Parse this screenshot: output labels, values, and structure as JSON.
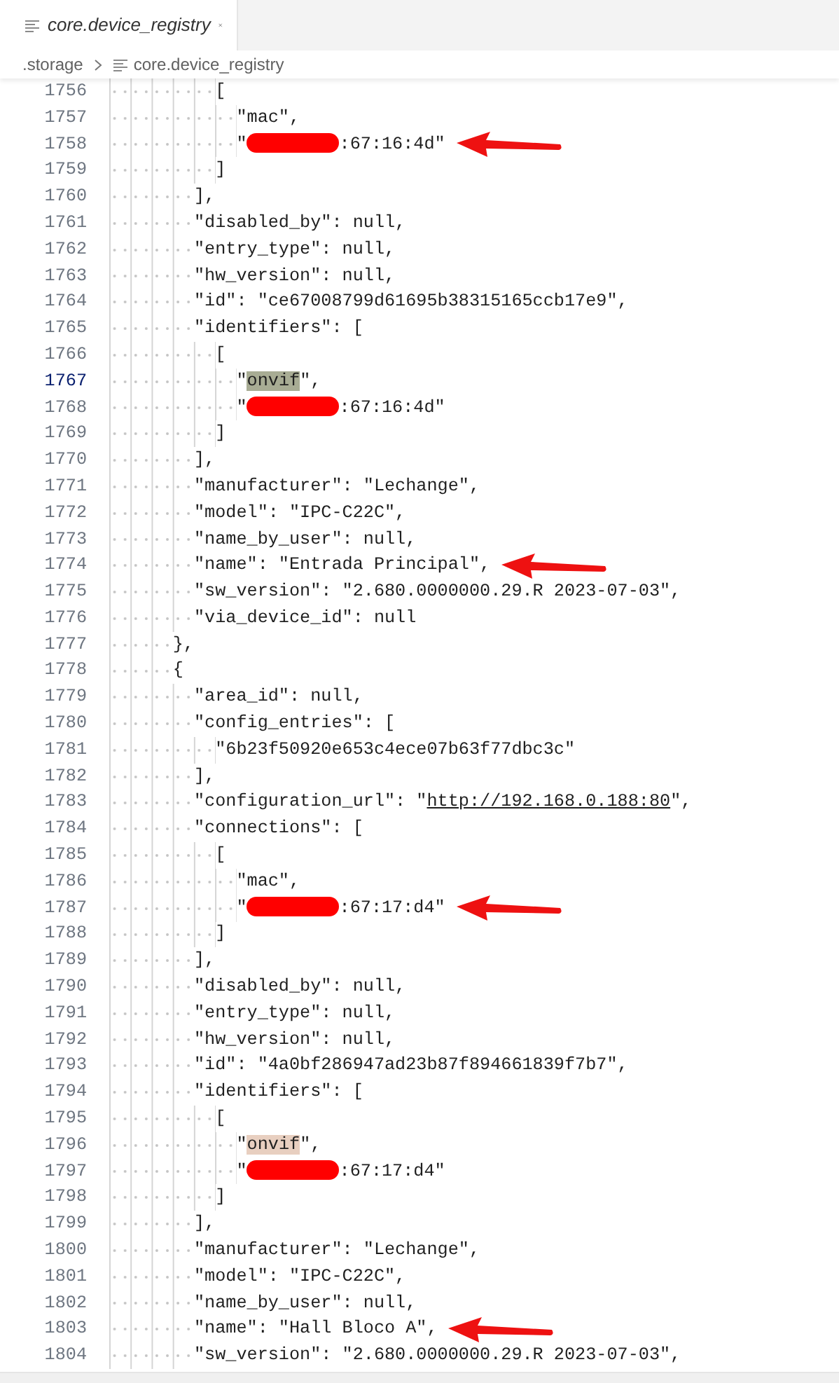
{
  "tab": {
    "label": "core.device_registry",
    "selected": true
  },
  "breadcrumb": [
    {
      "label": ".storage",
      "kind": "folder"
    },
    {
      "label": "core.device_registry",
      "kind": "file"
    }
  ],
  "lines": [
    {
      "number": "1756",
      "current": false,
      "arrow": false,
      "text": "          ["
    },
    {
      "number": "1757",
      "current": false,
      "arrow": false,
      "text": "            \"mac\","
    },
    {
      "number": "1758",
      "current": false,
      "arrow": true,
      "segments": [
        {
          "kind": "text",
          "text": "            \""
        },
        {
          "kind": "redaction"
        },
        {
          "kind": "text",
          "text": ":67:16:4d\""
        }
      ]
    },
    {
      "number": "1759",
      "current": false,
      "arrow": false,
      "text": "          ]"
    },
    {
      "number": "1760",
      "current": false,
      "arrow": false,
      "text": "        ],"
    },
    {
      "number": "1761",
      "current": false,
      "arrow": false,
      "text": "        \"disabled_by\": null,"
    },
    {
      "number": "1762",
      "current": false,
      "arrow": false,
      "text": "        \"entry_type\": null,"
    },
    {
      "number": "1763",
      "current": false,
      "arrow": false,
      "text": "        \"hw_version\": null,"
    },
    {
      "number": "1764",
      "current": false,
      "arrow": false,
      "text": "        \"id\": \"ce67008799d61695b38315165ccb17e9\","
    },
    {
      "number": "1765",
      "current": false,
      "arrow": false,
      "text": "        \"identifiers\": ["
    },
    {
      "number": "1766",
      "current": false,
      "arrow": false,
      "text": "          ["
    },
    {
      "number": "1767",
      "current": true,
      "arrow": false,
      "segments": [
        {
          "kind": "text",
          "text": "            \""
        },
        {
          "kind": "highlight",
          "text": "onvif",
          "color": "#a8ac94"
        },
        {
          "kind": "text",
          "text": "\","
        }
      ]
    },
    {
      "number": "1768",
      "current": false,
      "arrow": false,
      "segments": [
        {
          "kind": "text",
          "text": "            \""
        },
        {
          "kind": "redaction"
        },
        {
          "kind": "text",
          "text": ":67:16:4d\""
        }
      ]
    },
    {
      "number": "1769",
      "current": false,
      "arrow": false,
      "text": "          ]"
    },
    {
      "number": "1770",
      "current": false,
      "arrow": false,
      "text": "        ],"
    },
    {
      "number": "1771",
      "current": false,
      "arrow": false,
      "text": "        \"manufacturer\": \"Lechange\","
    },
    {
      "number": "1772",
      "current": false,
      "arrow": false,
      "text": "        \"model\": \"IPC-C22C\","
    },
    {
      "number": "1773",
      "current": false,
      "arrow": false,
      "text": "        \"name_by_user\": null,"
    },
    {
      "number": "1774",
      "current": false,
      "arrow": true,
      "text": "        \"name\": \"Entrada Principal\","
    },
    {
      "number": "1775",
      "current": false,
      "arrow": false,
      "text": "        \"sw_version\": \"2.680.0000000.29.R 2023-07-03\","
    },
    {
      "number": "1776",
      "current": false,
      "arrow": false,
      "text": "        \"via_device_id\": null"
    },
    {
      "number": "1777",
      "current": false,
      "arrow": false,
      "text": "      },"
    },
    {
      "number": "1778",
      "current": false,
      "arrow": false,
      "text": "      {"
    },
    {
      "number": "1779",
      "current": false,
      "arrow": false,
      "text": "        \"area_id\": null,"
    },
    {
      "number": "1780",
      "current": false,
      "arrow": false,
      "text": "        \"config_entries\": ["
    },
    {
      "number": "1781",
      "current": false,
      "arrow": false,
      "text": "          \"6b23f50920e653c4ece07b63f77dbc3c\""
    },
    {
      "number": "1782",
      "current": false,
      "arrow": false,
      "text": "        ],"
    },
    {
      "number": "1783",
      "current": false,
      "arrow": false,
      "segments": [
        {
          "kind": "text",
          "text": "        \"configuration_url\": \""
        },
        {
          "kind": "link",
          "text": "http://192.168.0.188:80"
        },
        {
          "kind": "text",
          "text": "\","
        }
      ]
    },
    {
      "number": "1784",
      "current": false,
      "arrow": false,
      "text": "        \"connections\": ["
    },
    {
      "number": "1785",
      "current": false,
      "arrow": false,
      "text": "          ["
    },
    {
      "number": "1786",
      "current": false,
      "arrow": false,
      "text": "            \"mac\","
    },
    {
      "number": "1787",
      "current": false,
      "arrow": true,
      "segments": [
        {
          "kind": "text",
          "text": "            \""
        },
        {
          "kind": "redaction"
        },
        {
          "kind": "text",
          "text": ":67:17:d4\""
        }
      ]
    },
    {
      "number": "1788",
      "current": false,
      "arrow": false,
      "text": "          ]"
    },
    {
      "number": "1789",
      "current": false,
      "arrow": false,
      "text": "        ],"
    },
    {
      "number": "1790",
      "current": false,
      "arrow": false,
      "text": "        \"disabled_by\": null,"
    },
    {
      "number": "1791",
      "current": false,
      "arrow": false,
      "text": "        \"entry_type\": null,"
    },
    {
      "number": "1792",
      "current": false,
      "arrow": false,
      "text": "        \"hw_version\": null,"
    },
    {
      "number": "1793",
      "current": false,
      "arrow": false,
      "text": "        \"id\": \"4a0bf286947ad23b87f894661839f7b7\","
    },
    {
      "number": "1794",
      "current": false,
      "arrow": false,
      "text": "        \"identifiers\": ["
    },
    {
      "number": "1795",
      "current": false,
      "arrow": false,
      "text": "          ["
    },
    {
      "number": "1796",
      "current": false,
      "arrow": false,
      "segments": [
        {
          "kind": "text",
          "text": "            \""
        },
        {
          "kind": "highlight",
          "text": "onvif",
          "color": "#e8cfc0"
        },
        {
          "kind": "text",
          "text": "\","
        }
      ]
    },
    {
      "number": "1797",
      "current": false,
      "arrow": false,
      "segments": [
        {
          "kind": "text",
          "text": "            \""
        },
        {
          "kind": "redaction"
        },
        {
          "kind": "text",
          "text": ":67:17:d4\""
        }
      ]
    },
    {
      "number": "1798",
      "current": false,
      "arrow": false,
      "text": "          ]"
    },
    {
      "number": "1799",
      "current": false,
      "arrow": false,
      "text": "        ],"
    },
    {
      "number": "1800",
      "current": false,
      "arrow": false,
      "text": "        \"manufacturer\": \"Lechange\","
    },
    {
      "number": "1801",
      "current": false,
      "arrow": false,
      "text": "        \"model\": \"IPC-C22C\","
    },
    {
      "number": "1802",
      "current": false,
      "arrow": false,
      "text": "        \"name_by_user\": null,"
    },
    {
      "number": "1803",
      "current": false,
      "arrow": true,
      "text": "        \"name\": \"Hall Bloco A\","
    },
    {
      "number": "1804",
      "current": false,
      "arrow": false,
      "text": "        \"sw_version\": \"2.680.0000000.29.R 2023-07-03\","
    }
  ]
}
